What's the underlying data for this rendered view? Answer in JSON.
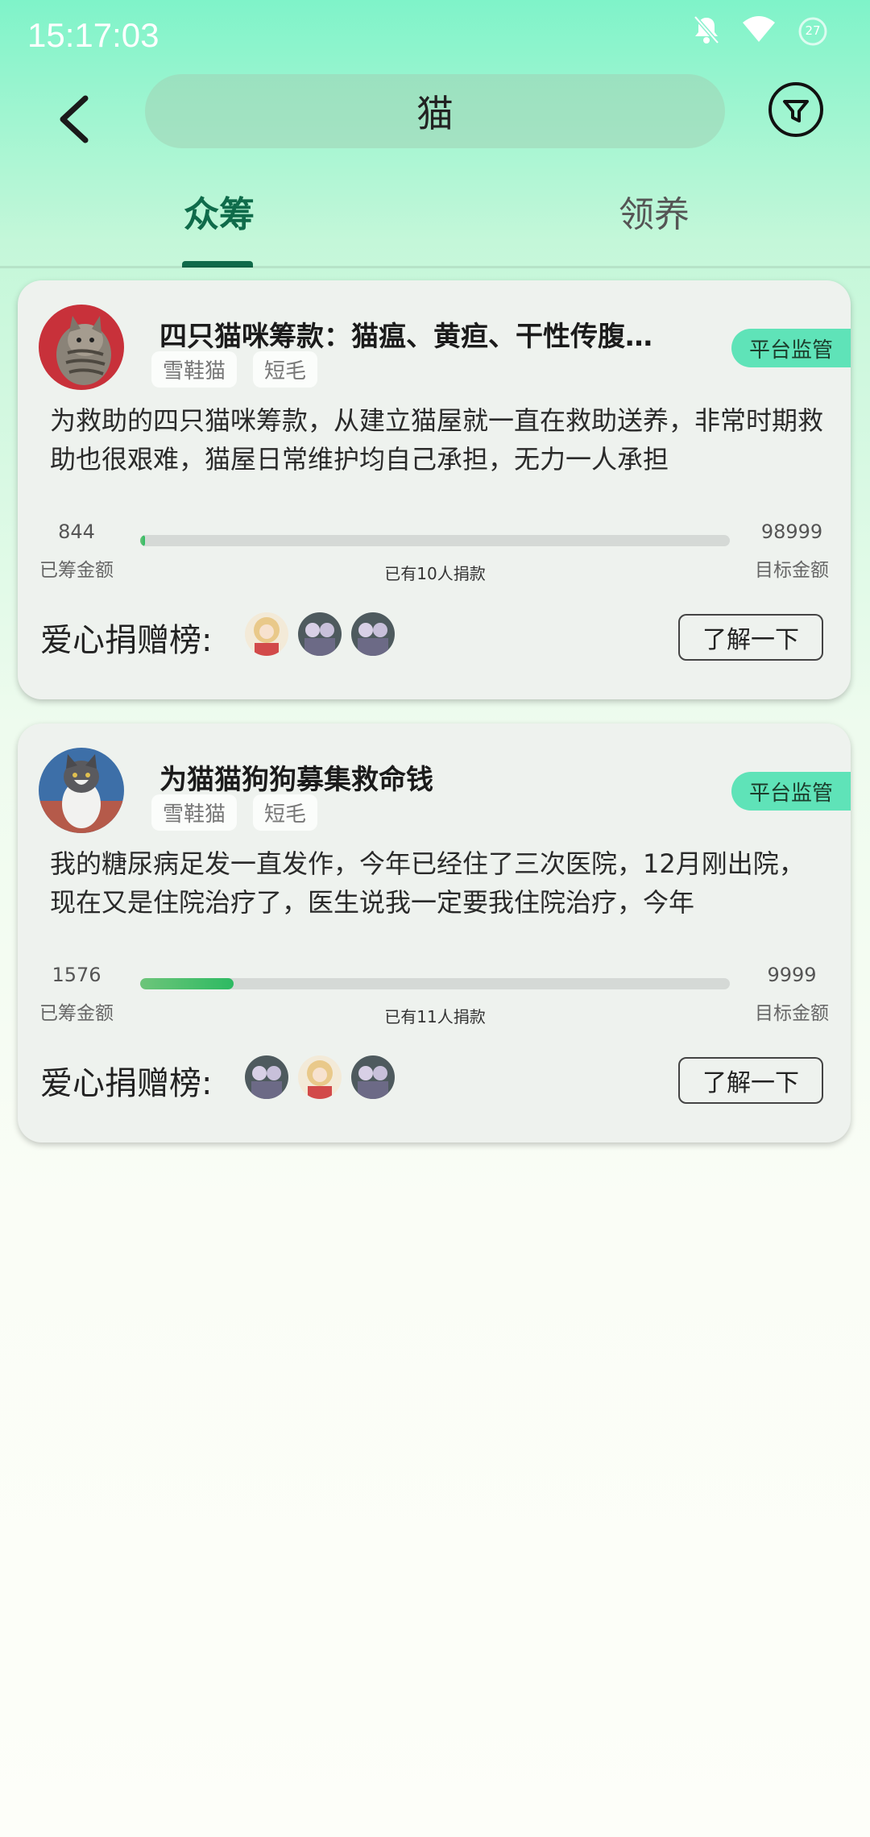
{
  "status_bar": {
    "time": "15:17:03",
    "battery_level": "27"
  },
  "header": {
    "search_query": "猫"
  },
  "tabs": [
    {
      "label": "众筹",
      "active": true
    },
    {
      "label": "领养",
      "active": false
    }
  ],
  "cards": [
    {
      "title": "四只猫咪筹款：猫瘟、黄疸、干性传腹…",
      "badge": "平台监管",
      "tags": [
        "雪鞋猫",
        "短毛"
      ],
      "description": "为救助的四只猫咪筹款，从建立猫屋就一直在救助送养，非常时期救助也很艰难，猫屋日常维护均自己承担，无力一人承担",
      "raised_amount": "844",
      "raised_label": "已筹金额",
      "goal_amount": "98999",
      "goal_label": "目标金额",
      "progress_fraction": 0.0085,
      "donor_count_text": "已有10人捐款",
      "board_label": "爱心捐赠榜:",
      "learn_more_label": "了解一下"
    },
    {
      "title": "为猫猫狗狗募集救命钱",
      "badge": "平台监管",
      "tags": [
        "雪鞋猫",
        "短毛"
      ],
      "description": "我的糖尿病足发一直发作，今年已经住了三次医院，12月刚出院，现在又是住院治疗了，医生说我一定要我住院治疗，今年",
      "raised_amount": "1576",
      "raised_label": "已筹金额",
      "goal_amount": "9999",
      "goal_label": "目标金额",
      "progress_fraction": 0.158,
      "donor_count_text": "已有11人捐款",
      "board_label": "爱心捐赠榜:",
      "learn_more_label": "了解一下"
    }
  ],
  "colors": {
    "accent": "#0f6b4a",
    "badge": "#5fe3b8",
    "progress": "#2dba62"
  }
}
